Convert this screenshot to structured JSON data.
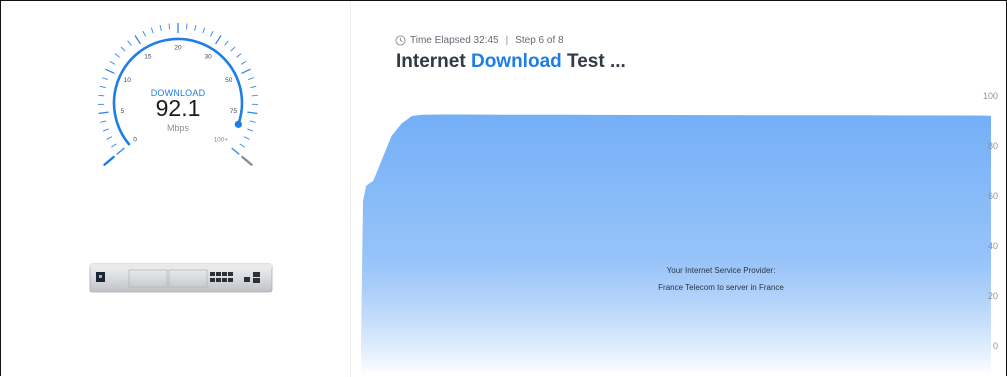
{
  "gauge": {
    "caption": "DOWNLOAD",
    "value": "92.1",
    "unit": "Mbps",
    "current_fraction": 0.921,
    "scale_labels": [
      "0",
      "5",
      "10",
      "15",
      "20",
      "30",
      "50",
      "75",
      "100+"
    ],
    "accent_color": "#1f7ee6",
    "tick_color": "#2f86ea",
    "end_needle_color": "#8a8f96"
  },
  "device": {
    "icon": "router-device-icon"
  },
  "header": {
    "clock_icon": "clock-icon",
    "elapsed": "Time Elapsed 32:45",
    "separator": "|",
    "step": "Step 6 of 8"
  },
  "title": {
    "prefix": "Internet",
    "accent": "Download",
    "suffix": "Test ..."
  },
  "chart_data": {
    "type": "area",
    "title": "",
    "xlabel": "",
    "ylabel": "",
    "ylim": [
      0,
      100
    ],
    "y_ticks": [
      "100",
      "80",
      "60",
      "40",
      "20",
      "0"
    ],
    "x": [
      0,
      2,
      5,
      8,
      12,
      16,
      22,
      30,
      40,
      50,
      60,
      80,
      100,
      150,
      200,
      300,
      400,
      500,
      600,
      620
    ],
    "values": [
      0,
      58,
      64,
      65,
      66,
      70,
      76,
      84,
      89,
      92,
      92.5,
      92.6,
      92.6,
      92.5,
      92.5,
      92.4,
      92.3,
      92.3,
      92.2,
      92.1
    ],
    "colors": {
      "fill_top": "#74aff7",
      "fill_bottom": "#ffffff",
      "tick_text": "#8d929a"
    }
  },
  "isp": {
    "label": "Your Internet Service Provider:",
    "value": "France Telecom to server in France"
  }
}
